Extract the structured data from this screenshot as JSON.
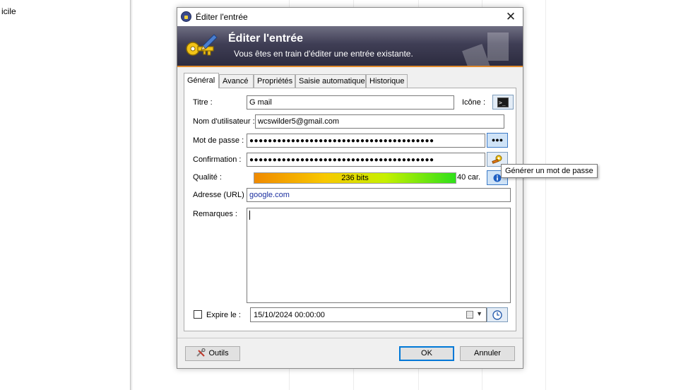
{
  "background": {
    "sidebar_text": "icile"
  },
  "dialog": {
    "title": "Éditer l'entrée",
    "close_glyph": "✕",
    "banner": {
      "title": "Éditer l'entrée",
      "subtitle": "Vous êtes en train d'éditer une entrée existante."
    },
    "tabs": [
      {
        "label": "Général",
        "active": true
      },
      {
        "label": "Avancé"
      },
      {
        "label": "Propriétés"
      },
      {
        "label": "Saisie automatique"
      },
      {
        "label": "Historique"
      }
    ],
    "general": {
      "title_label": "Titre :",
      "title_value": "G mail",
      "icon_label": "Icône :",
      "icon_name": "terminal-icon",
      "username_label": "Nom d'utilisateur :",
      "username_value": "wcswilder5@gmail.com",
      "password_label": "Mot de passe :",
      "password_mask": "●●●●●●●●●●●●●●●●●●●●●●●●●●●●●●●●●●●●●●●●",
      "reveal_label": "●●●",
      "confirm_label": "Confirmation :",
      "confirm_mask": "●●●●●●●●●●●●●●●●●●●●●●●●●●●●●●●●●●●●●●●●",
      "quality_label": "Qualité :",
      "quality_bits": "236 bits",
      "quality_chars": "40 car.",
      "url_label": "Adresse (URL) :",
      "url_value": "google.com",
      "notes_label": "Remarques :",
      "notes_value": "",
      "expires_label": "Expire le :",
      "expires_checked": false,
      "expires_value": "15/10/2024 00:00:00"
    },
    "tooltip": "Générer un mot de passe",
    "buttons": {
      "tools": "Outils",
      "ok": "OK",
      "cancel": "Annuler"
    },
    "colors": {
      "banner_accent": "#e08a2c",
      "default_button_border": "#0078d7",
      "url_text": "#1c2fa0"
    }
  }
}
